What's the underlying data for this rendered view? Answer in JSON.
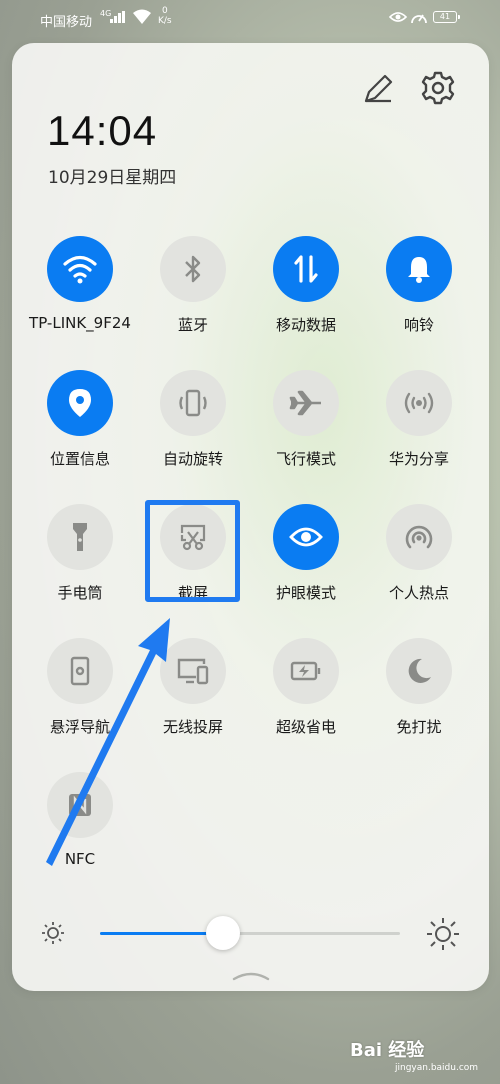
{
  "status_bar": {
    "carrier": "中国移动",
    "network_type": "4G",
    "speed_value": "0",
    "speed_unit": "K/s",
    "battery": "41"
  },
  "header": {
    "time": "14:04",
    "date": "10月29日星期四"
  },
  "tiles": [
    {
      "label": "TP-LINK_9F24",
      "icon": "wifi-icon",
      "on": true
    },
    {
      "label": "蓝牙",
      "icon": "bluetooth-icon",
      "on": false
    },
    {
      "label": "移动数据",
      "icon": "mobile-data-icon",
      "on": true
    },
    {
      "label": "响铃",
      "icon": "bell-icon",
      "on": true
    },
    {
      "label": "位置信息",
      "icon": "location-icon",
      "on": true
    },
    {
      "label": "自动旋转",
      "icon": "auto-rotate-icon",
      "on": false
    },
    {
      "label": "飞行模式",
      "icon": "airplane-icon",
      "on": false
    },
    {
      "label": "华为分享",
      "icon": "huawei-share-icon",
      "on": false
    },
    {
      "label": "手电筒",
      "icon": "flashlight-icon",
      "on": false
    },
    {
      "label": "截屏",
      "icon": "screenshot-icon",
      "on": false
    },
    {
      "label": "护眼模式",
      "icon": "eye-comfort-icon",
      "on": true
    },
    {
      "label": "个人热点",
      "icon": "hotspot-icon",
      "on": false
    },
    {
      "label": "悬浮导航",
      "icon": "floating-nav-icon",
      "on": false
    },
    {
      "label": "无线投屏",
      "icon": "wireless-projection-icon",
      "on": false
    },
    {
      "label": "超级省电",
      "icon": "ultra-power-saving-icon",
      "on": false
    },
    {
      "label": "免打扰",
      "icon": "moon-icon",
      "on": false
    },
    {
      "label": "NFC",
      "icon": "nfc-icon",
      "on": false
    }
  ],
  "brightness": {
    "level": 0.41
  },
  "colors": {
    "accent": "#0a7cf2",
    "tile_off": "#e2e3df",
    "annotation": "#1f7af0"
  },
  "watermark": {
    "brand": "Bai 经验",
    "url": "jingyan.baidu.com"
  }
}
